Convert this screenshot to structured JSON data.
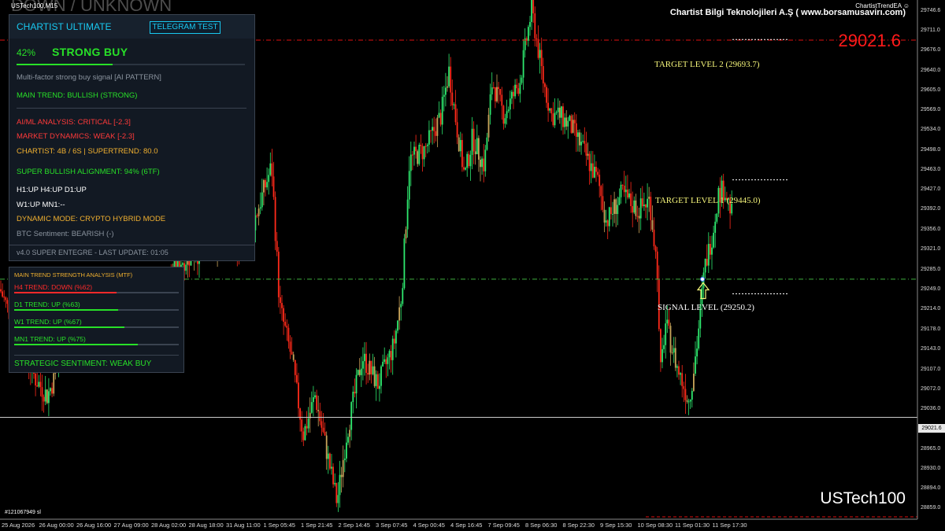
{
  "chart_header": {
    "symbol_label": "USTech100,M15",
    "ea_label": "ChartistTrendEA ☺",
    "company": "Chartist Bilgi Teknolojileri A.Ş ( www.borsamusavirı.com)",
    "watermark": "DOWN / UNKNOWN",
    "current_price_big": "29021.6",
    "symbol_big": "USTech100",
    "account_label": "#121067949 sl"
  },
  "colors": {
    "bull_candle": "#2ee86e",
    "bear_candle": "#ff2a1a",
    "neutral_candle": "#c8a45a",
    "target_level": "#f5f57a",
    "signal_level": "#ffffff",
    "dashed_red": "#e01010",
    "dashed_green": "#3fb03f",
    "accent_cyan": "#19c8f0",
    "panel_bg": "#121923"
  },
  "levels": {
    "target2": {
      "label": "TARGET LEVEL 2 (29693.7)",
      "price": 29693.7
    },
    "target1": {
      "label": "TARGET LEVEL 1 (29445.0)",
      "price": 29445.0
    },
    "signal": {
      "label": "SIGNAL LEVEL (29250.2)",
      "price": 29250.2
    },
    "red_line_price": 29694,
    "green_line_price": 29268,
    "current_line_price": 29021.6
  },
  "price_axis": {
    "ticks": [
      "29746.6",
      "29711.0",
      "29676.0",
      "29640.0",
      "29605.0",
      "29569.0",
      "29534.0",
      "29498.0",
      "29463.0",
      "29427.0",
      "29392.0",
      "29356.0",
      "29321.0",
      "29285.0",
      "29249.0",
      "29214.0",
      "29178.0",
      "29143.0",
      "29107.0",
      "29072.0",
      "29036.0",
      "29001.0",
      "28965.0",
      "28930.0",
      "28894.0",
      "28859.0"
    ],
    "current_label": "29021.6"
  },
  "time_axis": {
    "ticks": [
      "25 Aug 2026",
      "26 Aug 00:00",
      "26 Aug 16:00",
      "27 Aug 09:00",
      "28 Aug 02:00",
      "28 Aug 18:00",
      "31 Aug 11:00",
      "1 Sep 05:45",
      "1 Sep 21:45",
      "2 Sep 14:45",
      "3 Sep 07:45",
      "4 Sep 00:45",
      "4 Sep 16:45",
      "7 Sep 09:45",
      "8 Sep 06:30",
      "8 Sep 22:30",
      "9 Sep 15:30",
      "10 Sep 08:30",
      "11 Sep 01:30",
      "11 Sep 17:30"
    ]
  },
  "main_panel": {
    "title": "CHARTIST ULTIMATE",
    "telegram_button": "TELEGRAM TEST",
    "percent": "42%",
    "signal": "STRONG BUY",
    "strength_fraction": 0.42,
    "description": "Multi-factor strong buy signal [AI PATTERN]",
    "main_trend": "MAIN TREND: BULLISH (STRONG)",
    "ai_ml": "AI/ML ANALYSIS: CRITICAL [-2.3]",
    "market_dynamics": "MARKET DYNAMICS: WEAK [-2.3]",
    "chartist": "CHARTIST: 4B / 6S | SUPERTREND: 80.0",
    "alignment": "SUPER BULLISH ALIGNMENT: 94% (6TF)",
    "tf_line1": "H1:UP H4:UP D1:UP",
    "tf_line2": "W1:UP MN1:--",
    "dynamic_mode": "DYNAMIC MODE: CRYPTO HYBRID MODE",
    "btc_sentiment": "BTC Sentiment: BEARISH (-)",
    "footer": "v4.0 SUPER ENTEGRE - LAST UPDATE: 01:05"
  },
  "trend_panel": {
    "title": "MAIN TREND STRENGTH ANALYSIS (MTF)",
    "rows": [
      {
        "label": "H4 TREND: DOWN (%62)",
        "strength": 0.62,
        "color": "#ff2a2a"
      },
      {
        "label": "D1 TREND: UP (%63)",
        "strength": 0.63,
        "color": "#28e028"
      },
      {
        "label": "W1 TREND: UP (%67)",
        "strength": 0.67,
        "color": "#28e028"
      },
      {
        "label": "MN1 TREND: UP (%75)",
        "strength": 0.75,
        "color": "#28e028"
      }
    ],
    "sentiment": "STRATEGIC SENTIMENT: WEAK BUY"
  },
  "chart_data": {
    "type": "candlestick",
    "price_range": [
      28840,
      29770
    ],
    "path": [
      [
        0,
        29250
      ],
      [
        20,
        29180
      ],
      [
        45,
        29090
      ],
      [
        60,
        29060
      ],
      [
        80,
        29130
      ],
      [
        110,
        29170
      ],
      [
        140,
        29190
      ],
      [
        170,
        29230
      ],
      [
        200,
        29240
      ],
      [
        230,
        29300
      ],
      [
        260,
        29320
      ],
      [
        280,
        29340
      ],
      [
        300,
        29310
      ],
      [
        320,
        29360
      ],
      [
        345,
        29470
      ],
      [
        355,
        29220
      ],
      [
        370,
        29130
      ],
      [
        385,
        28990
      ],
      [
        400,
        29060
      ],
      [
        415,
        28960
      ],
      [
        428,
        28870
      ],
      [
        440,
        28990
      ],
      [
        460,
        29130
      ],
      [
        480,
        29080
      ],
      [
        500,
        29150
      ],
      [
        510,
        29240
      ],
      [
        520,
        29480
      ],
      [
        540,
        29500
      ],
      [
        560,
        29560
      ],
      [
        570,
        29640
      ],
      [
        580,
        29540
      ],
      [
        590,
        29450
      ],
      [
        600,
        29520
      ],
      [
        615,
        29470
      ],
      [
        625,
        29620
      ],
      [
        640,
        29560
      ],
      [
        660,
        29620
      ],
      [
        675,
        29750
      ],
      [
        690,
        29620
      ],
      [
        700,
        29560
      ],
      [
        710,
        29560
      ],
      [
        725,
        29540
      ],
      [
        740,
        29500
      ],
      [
        760,
        29440
      ],
      [
        770,
        29370
      ],
      [
        790,
        29420
      ],
      [
        810,
        29390
      ],
      [
        825,
        29410
      ],
      [
        835,
        29280
      ],
      [
        838,
        29090
      ],
      [
        845,
        29190
      ],
      [
        860,
        29110
      ],
      [
        875,
        29050
      ],
      [
        885,
        29150
      ],
      [
        895,
        29290
      ],
      [
        905,
        29350
      ],
      [
        912,
        29420
      ],
      [
        920,
        29430
      ],
      [
        930,
        29380
      ]
    ]
  }
}
